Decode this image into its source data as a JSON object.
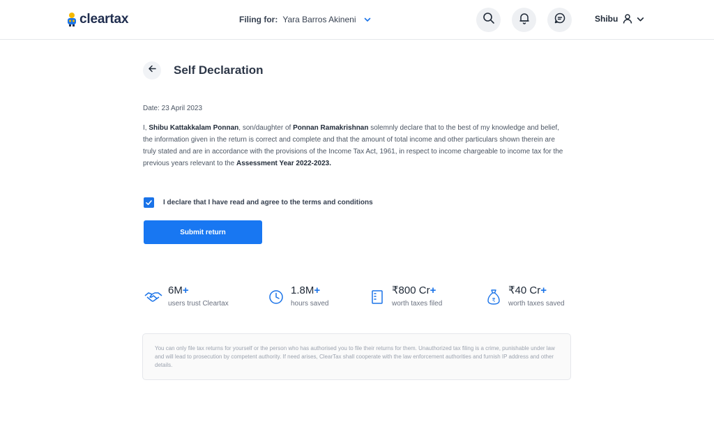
{
  "header": {
    "logo_text": "cleartax",
    "filing_label": "Filing for:",
    "filing_name": "Yara Barros Akineni",
    "user_name": "Shibu"
  },
  "page": {
    "title": "Self Declaration",
    "date_line": "Date: 23 April 2023"
  },
  "declaration": {
    "prefix": "I, ",
    "name": "Shibu Kattakkalam Ponnan",
    "middle": ", son/daughter of ",
    "parent_name": "Ponnan Ramakrishnan",
    "body": " solemnly declare that to the best of my knowledge and belief, the information given in the return is correct and complete and that the amount of total income and other particulars shown therein are truly stated and are in accordance with the provisions of the Income Tax Act, 1961, in respect to income chargeable to income tax for the previous years relevant to the ",
    "assessment_year": "Assessment Year 2022-2023."
  },
  "agree": {
    "checked": true,
    "label": "I declare that I have read and agree to the terms and conditions"
  },
  "submit_label": "Submit return",
  "stats": [
    {
      "value": "6M",
      "plus": "+",
      "label": "users trust Cleartax",
      "icon": "handshake-icon"
    },
    {
      "value": "1.8M",
      "plus": "+",
      "label": "hours saved",
      "icon": "clock-icon"
    },
    {
      "value": "₹800 Cr",
      "plus": "+",
      "label": "worth taxes filed",
      "icon": "document-icon"
    },
    {
      "value": "₹40 Cr",
      "plus": "+",
      "label": "worth taxes saved",
      "icon": "money-bag-icon"
    }
  ],
  "disclaimer": "You can only file tax returns for yourself or the person who has authorised you to file their returns for them. Unauthorized tax filing is a crime, punishable under law and will lead to prosecution by competent authority. If need arises, ClearTax shall cooperate with the law enforcement authorities and furnish IP address and other details.",
  "colors": {
    "accent": "#1877f2",
    "brand_navy": "#1f2d4e",
    "logo_yellow": "#f5b800"
  }
}
